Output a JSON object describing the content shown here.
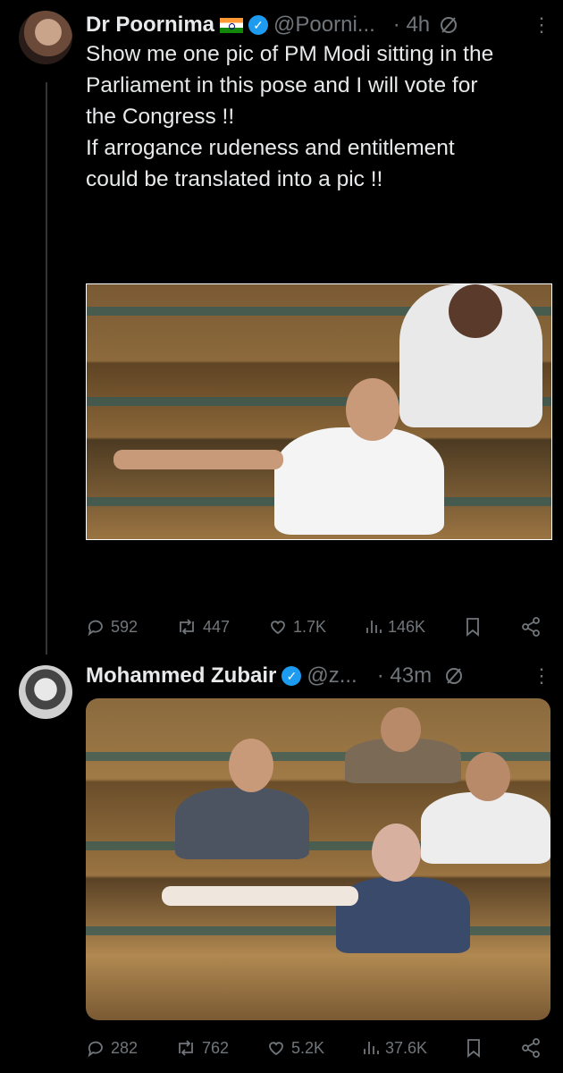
{
  "tweets": [
    {
      "name": "Dr Poornima",
      "flag_icon": "india-flag-icon",
      "handle": "@Poorni...",
      "time": "· 4h",
      "text": "Show me one pic of PM Modi sitting in the\nParliament in this pose and I will vote for\nthe Congress !!\nIf arrogance rudeness and entitlement\ncould be translated into a pic !!",
      "stats": {
        "replies": "592",
        "retweets": "447",
        "likes": "1.7K",
        "views": "146K"
      }
    },
    {
      "name": "Mohammed Zubair",
      "handle": "@z...",
      "time": "· 43m",
      "stats": {
        "replies": "282",
        "retweets": "762",
        "likes": "5.2K",
        "views": "37.6K"
      }
    }
  ],
  "colors": {
    "background": "#000000",
    "text": "#e7e9ea",
    "muted": "#71767b",
    "verified": "#1d9bf0"
  }
}
